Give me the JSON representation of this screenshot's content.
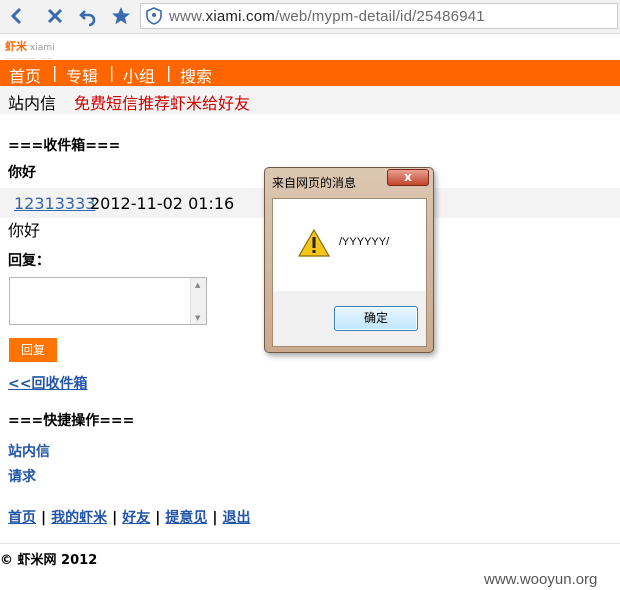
{
  "browser": {
    "address_prefix": "www.",
    "address_domain": "xiami.com",
    "address_path": "/web/mypm-detail/id/25486941"
  },
  "logo": {
    "cn": "虾米",
    "en": "xiami"
  },
  "nav": {
    "items": [
      "首页",
      "专辑",
      "小组",
      "搜索"
    ],
    "separator": "|"
  },
  "subnav": {
    "inbox_link": "站内信",
    "promo": "免费短信推荐虾米给好友"
  },
  "inbox": {
    "heading": "===收件箱===",
    "greeting": "你好",
    "sender": "12313333",
    "datetime": "2012-11-02 01:16",
    "body": "你好",
    "reply_label": "回复：",
    "reply_button": "回复",
    "back_link": "<<回收件箱"
  },
  "quick": {
    "heading": "===快捷操作===",
    "links": [
      "站内信",
      "请求"
    ]
  },
  "footer": {
    "links": [
      "首页",
      "我的虾米",
      "好友",
      "提意见",
      "退出"
    ],
    "separator": "|",
    "copyright": "© 虾米网  2012"
  },
  "watermark": "www.wooyun.org",
  "dialog": {
    "title": "来自网页的消息",
    "close_glyph": "x",
    "message": "/YYYYYY/",
    "ok_button": "确定"
  },
  "colors": {
    "brand_orange": "#ff6600",
    "promo_red": "#cc0000",
    "link_blue": "#2255aa"
  }
}
